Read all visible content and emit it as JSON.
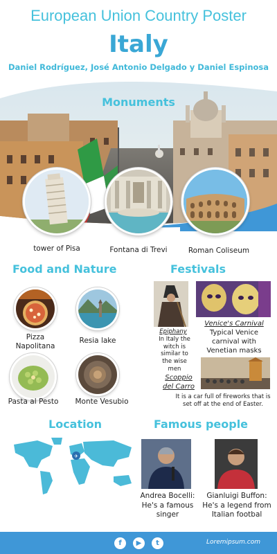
{
  "header": {
    "title": "European Union Country Poster",
    "country": "Italy",
    "authors": "Daniel Rodríguez, José Antonio Delgado y Daniel Espinosa"
  },
  "monuments": {
    "heading": "Monuments",
    "items": [
      {
        "label": "tower of Pisa",
        "icon": "leaning-tower-icon"
      },
      {
        "label": "Fontana di Trevi",
        "icon": "fountain-icon"
      },
      {
        "label": "Roman Coliseum",
        "icon": "coliseum-icon"
      }
    ]
  },
  "food": {
    "heading": "Food and Nature",
    "items": [
      {
        "label": "Pizza Napolitana"
      },
      {
        "label": "Resia lake"
      },
      {
        "label": "Pasta al Pesto"
      },
      {
        "label": "Monte Vesubio"
      }
    ]
  },
  "festivals": {
    "heading": "Festivals",
    "epiphany": {
      "title": "Epiphany",
      "desc": "In Italy the witch is similar to the wise men"
    },
    "carnival": {
      "title": "Venice's Carnival",
      "desc": "Typical Venice carnival with Venetian masks"
    },
    "scoppio": {
      "title": "Scoppio del Carro",
      "desc": "It is a car full of fireworks that is set off at the end of Easter."
    }
  },
  "location": {
    "heading": "Location"
  },
  "people": {
    "heading": "Famous people",
    "items": [
      {
        "caption": "Andrea Bocelli: He's a famous singer"
      },
      {
        "caption": "Gianluigi Buffon: He's a legend from Italian footbal"
      }
    ]
  },
  "footer": {
    "link": "Loremipsum.com",
    "icons": [
      "facebook-icon",
      "youtube-icon",
      "twitter-icon"
    ]
  },
  "colors": {
    "accent": "#45c1dc",
    "footer": "#3f97d7",
    "flag_green": "#2f9a45",
    "flag_red": "#d23a36"
  }
}
